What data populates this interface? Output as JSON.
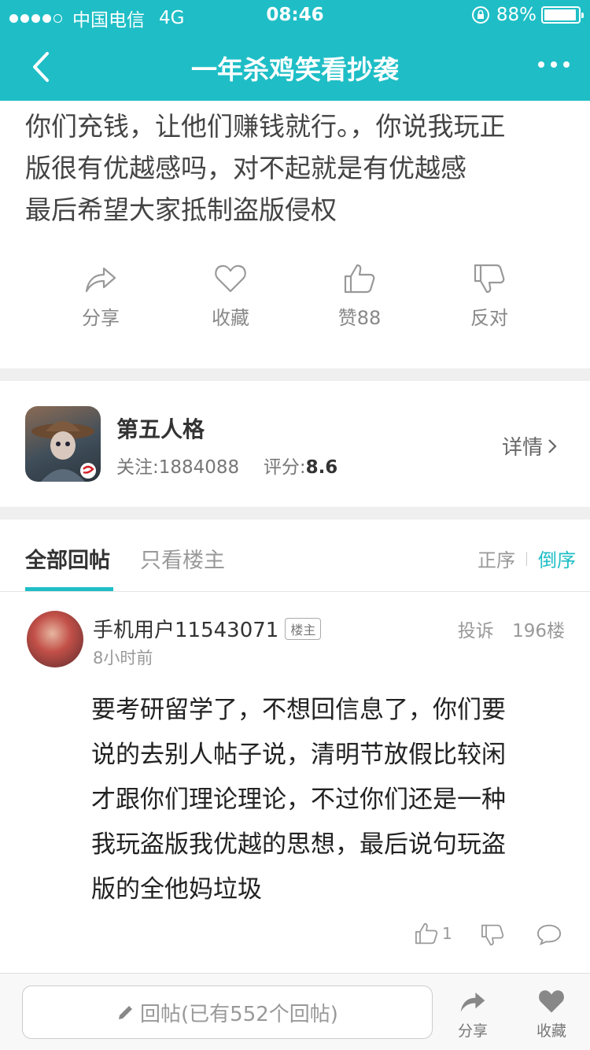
{
  "status_bar": {
    "carrier": "中国电信",
    "network": "4G",
    "time": "08:46",
    "battery": "88%"
  },
  "nav": {
    "title": "一年杀鸡笑看抄袭"
  },
  "post": {
    "text_lines": [
      "你们充钱，让他们赚钱就行。，你说我玩正",
      "版很有优越感吗，对不起就是有优越感",
      "最后希望大家抵制盗版侵权"
    ],
    "actions": {
      "share": "分享",
      "favorite": "收藏",
      "like": "赞88",
      "dislike": "反对"
    }
  },
  "game": {
    "name": "第五人格",
    "followers_label": "关注:1884088",
    "rating_label": "评分:",
    "rating_value": "8.6",
    "details": "详情"
  },
  "tabs": {
    "all": "全部回帖",
    "op_only": "只看楼主",
    "sort_asc": "正序",
    "sort_desc": "倒序"
  },
  "reply": {
    "username": "手机用户11543071",
    "badge": "楼主",
    "time": "8小时前",
    "report": "投诉",
    "floor": "196楼",
    "text_lines": [
      "要考研留学了，不想回信息了，你们要",
      "说的去别人帖子说，清明节放假比较闲",
      "才跟你们理论理论，不过你们还是一种",
      "我玩盗版我优越的思想，最后说句玩盗",
      "版的全他妈垃圾"
    ],
    "like_count": "1"
  },
  "bottom_bar": {
    "input_placeholder": "回帖(已有552个回帖)",
    "share": "分享",
    "favorite": "收藏"
  },
  "colors": {
    "accent": "#1fbec6",
    "text": "#333333",
    "muted": "#999999"
  }
}
